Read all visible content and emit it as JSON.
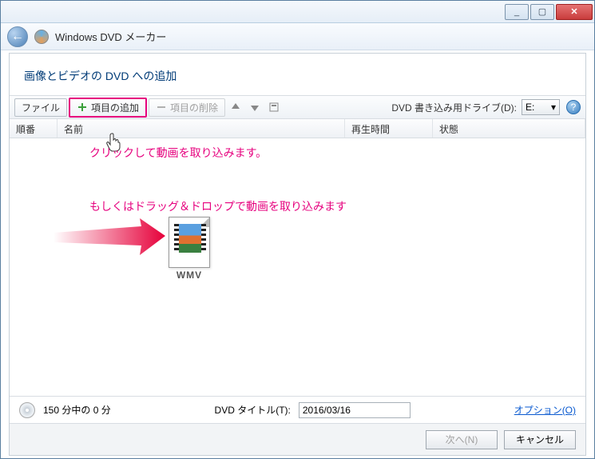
{
  "titlebar": {
    "min": "_",
    "max": "▢",
    "close": "✕"
  },
  "app": {
    "title": "Windows DVD メーカー"
  },
  "heading": "画像とビデオの DVD への追加",
  "toolbar": {
    "file": "ファイル",
    "add": "項目の追加",
    "remove": "項目の削除",
    "drive_label": "DVD 書き込み用ドライブ(D):",
    "drive_value": "E:"
  },
  "columns": {
    "order": "順番",
    "name": "名前",
    "duration": "再生時間",
    "status": "状態"
  },
  "annotations": {
    "click": "クリックして動画を取り込みます。",
    "drag": "もしくはドラッグ＆ドロップで動画を取り込みます"
  },
  "file_icon": {
    "label": "WMV"
  },
  "status": {
    "minutes": "150 分中の 0 分",
    "title_label": "DVD タイトル(T):",
    "title_value": "2016/03/16",
    "options": "オプション(O)"
  },
  "footer": {
    "next": "次へ(N)",
    "cancel": "キャンセル"
  }
}
